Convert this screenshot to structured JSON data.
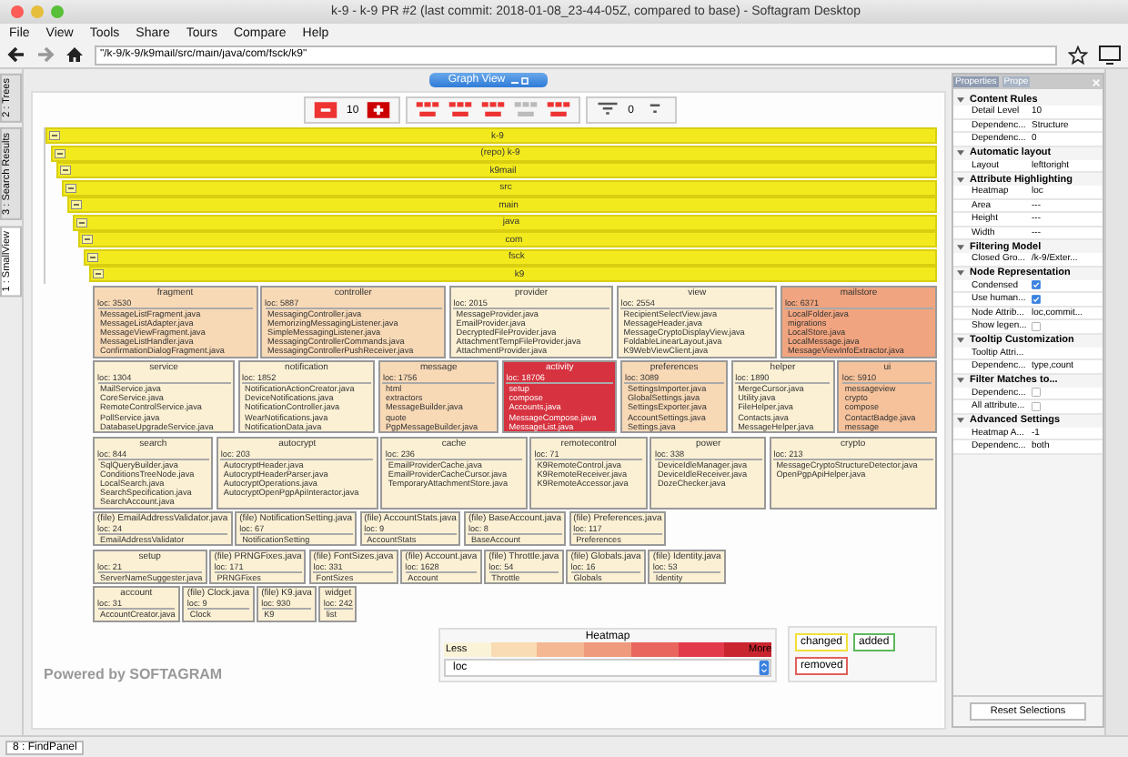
{
  "window": {
    "title": "k-9 - k-9 PR #2 (last commit: 2018-01-08_23-44-05Z, compared to base) - Softagram Desktop"
  },
  "menu": [
    "File",
    "View",
    "Tools",
    "Share",
    "Tours",
    "Compare",
    "Help"
  ],
  "address": {
    "value": "\"/k-9/k-9/k9mail/src/main/java/com/fsck/k9\""
  },
  "side_tabs": [
    {
      "label": "2 : Trees",
      "selected": false
    },
    {
      "label": "3 : Search Results",
      "selected": false
    },
    {
      "label": "1 : SmallView",
      "selected": true
    }
  ],
  "graph_view_button": "Graph View",
  "toolbar": {
    "detail_level": "10",
    "count": "0"
  },
  "tree": {
    "label": "k-9",
    "expanded": true,
    "children": [
      {
        "label": "(repo) k-9",
        "expanded": true,
        "children": [
          {
            "label": "k9mail",
            "expanded": true,
            "children": [
              {
                "label": "src",
                "expanded": true,
                "children": [
                  {
                    "label": "main",
                    "expanded": true,
                    "children": [
                      {
                        "label": "java",
                        "expanded": true,
                        "children": [
                          {
                            "label": "com",
                            "expanded": true,
                            "children": [
                              {
                                "label": "fsck",
                                "expanded": true,
                                "children": [
                                  {
                                    "label": "k9",
                                    "expanded": true
                                  }
                                ]
                              }
                            ]
                          }
                        ]
                      }
                    ]
                  }
                ]
              }
            ]
          }
        ]
      }
    ]
  },
  "module_rows": [
    [
      {
        "name": "fragment",
        "loc": "loc: 3530",
        "color": "#f8d9b6",
        "files": [
          "MessageListFragment.java",
          "MessageListAdapter.java",
          "MessageViewFragment.java",
          "MessageListHandler.java",
          "ConfirmationDialogFragment.java"
        ]
      },
      {
        "name": "controller",
        "loc": "loc: 5887",
        "color": "#f8d9b6",
        "files": [
          "MessagingController.java",
          "MemorizingMessagingListener.java",
          "SimpleMessagingListener.java",
          "MessagingControllerCommands.java",
          "MessagingControllerPushReceiver.java"
        ]
      },
      {
        "name": "provider",
        "loc": "loc: 2015",
        "color": "#fbf0d4",
        "files": [
          "MessageProvider.java",
          "EmailProvider.java",
          "DecryptedFileProvider.java",
          "AttachmentTempFileProvider.java",
          "AttachmentProvider.java"
        ]
      },
      {
        "name": "view",
        "loc": "loc: 2554",
        "color": "#fbf0d4",
        "files": [
          "RecipientSelectView.java",
          "MessageHeader.java",
          "MessageCryptoDisplayView.java",
          "FoldableLinearLayout.java",
          "K9WebViewClient.java"
        ]
      },
      {
        "name": "mailstore",
        "loc": "loc: 6371",
        "color": "#f0a47f",
        "files": [
          "LocalFolder.java",
          "migrations",
          "LocalStore.java",
          "LocalMessage.java",
          "MessageViewInfoExtractor.java"
        ]
      }
    ],
    [
      {
        "name": "service",
        "loc": "loc: 1304",
        "color": "#fbf0d4",
        "files": [
          "MailService.java",
          "CoreService.java",
          "RemoteControlService.java",
          "PollService.java",
          "DatabaseUpgradeService.java"
        ]
      },
      {
        "name": "notification",
        "loc": "loc: 1852",
        "color": "#fbf0d4",
        "files": [
          "NotificationActionCreator.java",
          "DeviceNotifications.java",
          "NotificationController.java",
          "WearNotifications.java",
          "NotificationData.java"
        ]
      },
      {
        "name": "message",
        "loc": "loc: 1756",
        "color": "#f8d9b6",
        "files": [
          "html",
          "extractors",
          "MessageBuilder.java",
          "quote",
          "PgpMessageBuilder.java"
        ]
      },
      {
        "name": "activity",
        "loc": "loc: 18706",
        "color": "#d6323f",
        "files": [
          "setup",
          "compose",
          "Accounts.java",
          "MessageCompose.java",
          "MessageList.java"
        ]
      },
      {
        "name": "preferences",
        "loc": "loc: 3089",
        "color": "#f8d9b6",
        "files": [
          "SettingsImporter.java",
          "GlobalSettings.java",
          "SettingsExporter.java",
          "AccountSettings.java",
          "Settings.java"
        ]
      },
      {
        "name": "helper",
        "loc": "loc: 1890",
        "color": "#fbf0d4",
        "files": [
          "MergeCursor.java",
          "Utility.java",
          "FileHelper.java",
          "Contacts.java",
          "MessageHelper.java"
        ]
      },
      {
        "name": "ui",
        "loc": "loc: 5910",
        "color": "#f5c29c",
        "files": [
          "messageview",
          "crypto",
          "compose",
          "ContactBadge.java",
          "message"
        ]
      }
    ],
    [
      {
        "name": "search",
        "loc": "loc: 844",
        "color": "#fbf0d4",
        "files": [
          "SqlQueryBuilder.java",
          "ConditionsTreeNode.java",
          "LocalSearch.java",
          "SearchSpecification.java",
          "SearchAccount.java"
        ]
      },
      {
        "name": "autocrypt",
        "loc": "loc: 203",
        "color": "#fbf0d4",
        "files": [
          "AutocryptHeader.java",
          "AutocryptHeaderParser.java",
          "AutocryptOperations.java",
          "AutocryptOpenPgpApiInteractor.java"
        ]
      },
      {
        "name": "cache",
        "loc": "loc: 236",
        "color": "#fbf0d4",
        "files": [
          "EmailProviderCache.java",
          "EmailProviderCacheCursor.java",
          "TemporaryAttachmentStore.java"
        ]
      },
      {
        "name": "remotecontrol",
        "loc": "loc: 71",
        "color": "#fbf0d4",
        "files": [
          "K9RemoteControl.java",
          "K9RemoteReceiver.java",
          "K9RemoteAccessor.java"
        ]
      },
      {
        "name": "power",
        "loc": "loc: 338",
        "color": "#fbf0d4",
        "files": [
          "DeviceIdleManager.java",
          "DeviceIdleReceiver.java",
          "DozeChecker.java"
        ]
      },
      {
        "name": "crypto",
        "loc": "loc: 213",
        "color": "#fbf0d4",
        "files": [
          "MessageCryptoStructureDetector.java",
          "OpenPgpApiHelper.java"
        ]
      }
    ],
    [
      {
        "name": "(file) EmailAddressValidator.java",
        "loc": "loc: 24",
        "color": "#fbf0d4",
        "files": [
          "EmailAddressValidator"
        ]
      },
      {
        "name": "(file) NotificationSetting.java",
        "loc": "loc: 67",
        "color": "#fbf0d4",
        "files": [
          "NotificationSetting"
        ]
      },
      {
        "name": "(file) AccountStats.java",
        "loc": "loc: 9",
        "color": "#fbf0d4",
        "files": [
          "AccountStats"
        ]
      },
      {
        "name": "(file) BaseAccount.java",
        "loc": "loc: 8",
        "color": "#fbf0d4",
        "files": [
          "BaseAccount"
        ]
      },
      {
        "name": "(file) Preferences.java",
        "loc": "loc: 117",
        "color": "#fbf0d4",
        "files": [
          "Preferences"
        ]
      }
    ],
    [
      {
        "name": "setup",
        "loc": "loc: 21",
        "color": "#fbf0d4",
        "files": [
          "ServerNameSuggester.java"
        ]
      },
      {
        "name": "(file) PRNGFixes.java",
        "loc": "loc: 171",
        "color": "#fbf0d4",
        "files": [
          "PRNGFixes"
        ]
      },
      {
        "name": "(file) FontSizes.java",
        "loc": "loc: 331",
        "color": "#fbf0d4",
        "files": [
          "FontSizes"
        ]
      },
      {
        "name": "(file) Account.java",
        "loc": "loc: 1628",
        "color": "#fbf0d4",
        "files": [
          "Account"
        ]
      },
      {
        "name": "(file) Throttle.java",
        "loc": "loc: 54",
        "color": "#fbf0d4",
        "files": [
          "Throttle"
        ]
      },
      {
        "name": "(file) Globals.java",
        "loc": "loc: 16",
        "color": "#fbf0d4",
        "files": [
          "Globals"
        ]
      },
      {
        "name": "(file) Identity.java",
        "loc": "loc: 53",
        "color": "#fbf0d4",
        "files": [
          "Identity"
        ]
      }
    ],
    [
      {
        "name": "account",
        "loc": "loc: 31",
        "color": "#fbf0d4",
        "files": [
          "AccountCreator.java"
        ]
      },
      {
        "name": "(file) Clock.java",
        "loc": "loc: 9",
        "color": "#fbf0d4",
        "files": [
          "Clock"
        ]
      },
      {
        "name": "(file) K9.java",
        "loc": "loc: 930",
        "color": "#fbf0d4",
        "files": [
          "K9"
        ]
      },
      {
        "name": "widget",
        "loc": "loc: 242",
        "color": "#fbf0d4",
        "files": [
          "list"
        ]
      }
    ]
  ],
  "powered_by": "Powered by SOFTAGRAM",
  "heatmap": {
    "title": "Heatmap",
    "less": "Less",
    "more": "More",
    "metric": "loc",
    "scale": [
      {
        "color": "#fbf3d8"
      },
      {
        "color": "#f9dcb4"
      },
      {
        "color": "#f4b893"
      },
      {
        "color": "#ef9a7c"
      },
      {
        "color": "#e8665e"
      },
      {
        "color": "#e23a4a"
      },
      {
        "color": "#c9252f"
      }
    ]
  },
  "diff_legend": [
    {
      "label": "changed",
      "color": "#f2df3a"
    },
    {
      "label": "added",
      "color": "#5cb85c"
    },
    {
      "label": "removed",
      "color": "#e0605a"
    }
  ],
  "properties": {
    "tabs": [
      {
        "label": "Properties",
        "selected": true
      },
      {
        "label": "Prope",
        "selected": false
      }
    ],
    "sections": [
      {
        "title": "Content Rules",
        "expanded": true,
        "rows": [
          {
            "label": "Detail Level",
            "kind": "text",
            "value": "10"
          },
          {
            "label": "Dependenc...",
            "kind": "text",
            "value": "Structure"
          },
          {
            "label": "Dependenc...",
            "kind": "text",
            "value": "0"
          }
        ]
      },
      {
        "title": "Automatic layout",
        "expanded": true,
        "rows": [
          {
            "label": "Layout",
            "kind": "text",
            "value": "lefttoright"
          }
        ]
      },
      {
        "title": "Attribute Highlighting",
        "expanded": true,
        "rows": [
          {
            "label": "Heatmap",
            "kind": "text",
            "value": "loc"
          },
          {
            "label": "Area",
            "kind": "text",
            "value": "---"
          },
          {
            "label": "Height",
            "kind": "text",
            "value": "---"
          },
          {
            "label": "Width",
            "kind": "text",
            "value": "---"
          }
        ]
      },
      {
        "title": "Filtering Model",
        "expanded": true,
        "rows": [
          {
            "label": "Closed Gro...",
            "kind": "text",
            "value": "/k-9/Exter..."
          }
        ]
      },
      {
        "title": "Node Representation",
        "expanded": true,
        "rows": [
          {
            "label": "Condensed",
            "kind": "checkbox",
            "checked": true
          },
          {
            "label": "Use human...",
            "kind": "checkbox",
            "checked": true
          },
          {
            "label": "Node Attrib...",
            "kind": "text",
            "value": "loc,commit..."
          },
          {
            "label": "Show legen...",
            "kind": "checkbox",
            "checked": false
          }
        ]
      },
      {
        "title": "Tooltip Customization",
        "expanded": true,
        "rows": [
          {
            "label": "Tooltip Attri...",
            "kind": "text"
          },
          {
            "label": "Dependenc...",
            "kind": "text",
            "value": "type,count"
          }
        ]
      },
      {
        "title": "Filter Matches to...",
        "expanded": true,
        "rows": [
          {
            "label": "Dependenc...",
            "kind": "checkbox",
            "checked": false
          },
          {
            "label": "All attribute...",
            "kind": "checkbox",
            "checked": false
          }
        ]
      },
      {
        "title": "Advanced Settings",
        "expanded": true,
        "rows": [
          {
            "label": "Heatmap A...",
            "kind": "text",
            "value": "-1"
          },
          {
            "label": "Dependenc...",
            "kind": "text",
            "value": "both"
          }
        ]
      }
    ],
    "reset_button": "Reset Selections"
  },
  "bottom_tab": "8 : FindPanel"
}
